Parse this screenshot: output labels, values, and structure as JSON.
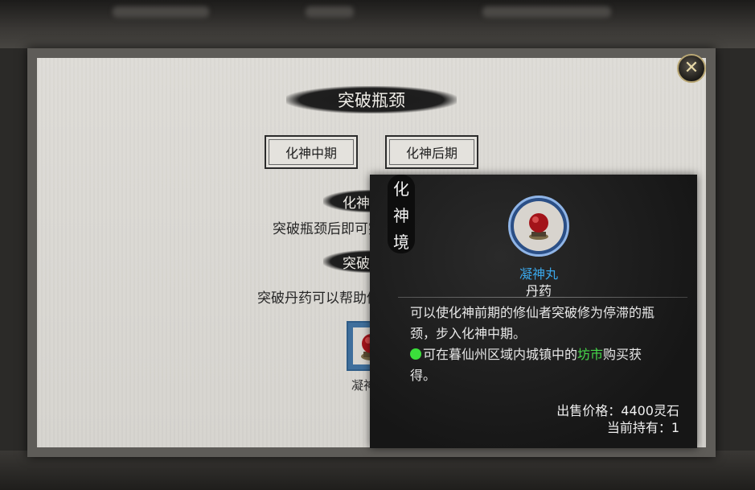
{
  "dialog": {
    "title": "突破瓶颈",
    "close_icon": "close-icon"
  },
  "tabs": [
    {
      "label": "化神中期"
    },
    {
      "label": "化神后期"
    }
  ],
  "sections": [
    {
      "heading": "化神中期",
      "description": "突破瓶颈后即可突破化神中期"
    },
    {
      "heading": "突破丹药",
      "description": "突破丹药可以帮助修仙者突破瓶颈"
    }
  ],
  "item_slot": {
    "icon": "red-orb-pill-icon",
    "label": "凝神丸"
  },
  "realm_tag": [
    "化",
    "神",
    "境"
  ],
  "tooltip": {
    "name": "凝神丸",
    "type": "丹药",
    "description": "可以使化神前期的修仙者突破修为停滞的瓶颈，步入化神中期。",
    "source_prefix": "可在暮仙州区域内城镇中的",
    "source_link": "坊市",
    "source_suffix": "购买获得。",
    "price": "出售价格：4400灵石",
    "held": "当前持有：1"
  },
  "colors": {
    "item_name": "#3aa6e8",
    "market_link": "#46d84a",
    "status_dot": "#3be03b"
  }
}
